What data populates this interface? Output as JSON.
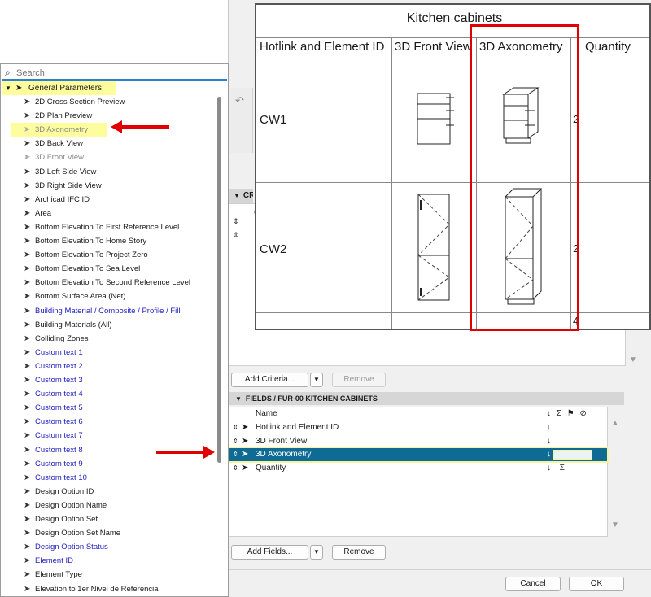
{
  "search": {
    "placeholder": "Search"
  },
  "tree": {
    "group_label": "General Parameters",
    "items": [
      {
        "label": "2D Cross Section Preview",
        "style": ""
      },
      {
        "label": "2D Plan Preview",
        "style": ""
      },
      {
        "label": "3D Axonometry",
        "style": "grey hl"
      },
      {
        "label": "3D Back View",
        "style": ""
      },
      {
        "label": "3D Front View",
        "style": "grey"
      },
      {
        "label": "3D Left Side View",
        "style": ""
      },
      {
        "label": "3D Right Side View",
        "style": ""
      },
      {
        "label": "Archicad IFC ID",
        "style": ""
      },
      {
        "label": "Area",
        "style": ""
      },
      {
        "label": "Bottom Elevation To First Reference Level",
        "style": ""
      },
      {
        "label": "Bottom Elevation To Home Story",
        "style": ""
      },
      {
        "label": "Bottom Elevation To Project Zero",
        "style": ""
      },
      {
        "label": "Bottom Elevation To Sea Level",
        "style": ""
      },
      {
        "label": "Bottom Elevation To Second Reference Level",
        "style": ""
      },
      {
        "label": "Bottom Surface Area (Net)",
        "style": ""
      },
      {
        "label": "Building Material / Composite / Profile / Fill",
        "style": "blue"
      },
      {
        "label": "Building Materials (All)",
        "style": ""
      },
      {
        "label": "Colliding Zones",
        "style": ""
      },
      {
        "label": "Custom text  1",
        "style": "blue"
      },
      {
        "label": "Custom text  2",
        "style": "blue"
      },
      {
        "label": "Custom text  3",
        "style": "blue"
      },
      {
        "label": "Custom text  4",
        "style": "blue"
      },
      {
        "label": "Custom text  5",
        "style": "blue"
      },
      {
        "label": "Custom text  6",
        "style": "blue"
      },
      {
        "label": "Custom text  7",
        "style": "blue"
      },
      {
        "label": "Custom text  8",
        "style": "blue"
      },
      {
        "label": "Custom text  9",
        "style": "blue"
      },
      {
        "label": "Custom text 10",
        "style": "blue"
      },
      {
        "label": "Design Option ID",
        "style": ""
      },
      {
        "label": "Design Option Name",
        "style": ""
      },
      {
        "label": "Design Option Set",
        "style": ""
      },
      {
        "label": "Design Option Set Name",
        "style": ""
      },
      {
        "label": "Design Option Status",
        "style": "blue"
      },
      {
        "label": "Element ID",
        "style": "blue"
      },
      {
        "label": "Element Type",
        "style": ""
      },
      {
        "label": "Elevation to 1er Nivel de Referencia",
        "style": ""
      }
    ]
  },
  "dialog": {
    "criteria_header": "CRIT",
    "add_criteria": "Add Criteria...",
    "remove_criteria": "Remove",
    "fields_header": "FIELDS / FUR-00 KITCHEN CABINETS",
    "name_col": "Name",
    "col_icons": "↓ Σ ⚑ ⊘",
    "fields": [
      {
        "label": "Hotlink and Element ID",
        "sym": "↓",
        "selected": false
      },
      {
        "label": "3D Front View",
        "sym": "↓",
        "selected": false
      },
      {
        "label": "3D Axonometry",
        "sym": "↓",
        "selected": true
      },
      {
        "label": "Quantity",
        "sym": "↓ Σ",
        "selected": false
      }
    ],
    "add_fields": "Add Fields...",
    "remove_fields": "Remove",
    "cancel": "Cancel",
    "ok": "OK"
  },
  "schedule": {
    "title": "Kitchen cabinets",
    "columns": [
      "Hotlink and Element ID",
      "3D Front View",
      "3D Axonometry",
      "Quantity"
    ],
    "rows": [
      {
        "id": "CW1",
        "qty": "2"
      },
      {
        "id": "CW2",
        "qty": "2"
      },
      {
        "id": "",
        "qty": "4"
      }
    ]
  },
  "colors": {
    "highlight": "#e00000",
    "selected_row": "#0f6b93",
    "marker": "#fdfd9e",
    "link_blue": "#2020c0"
  }
}
